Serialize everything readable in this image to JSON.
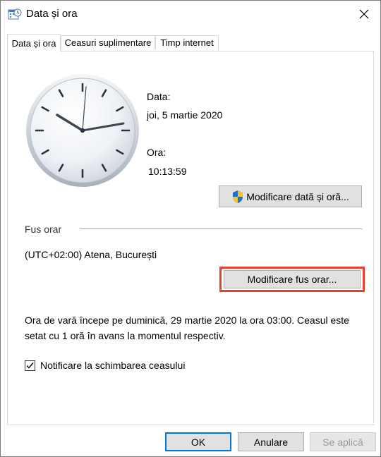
{
  "window": {
    "title": "Data și ora",
    "close_icon": "close-icon"
  },
  "tabs": [
    {
      "label": "Data și ora",
      "active": true
    },
    {
      "label": "Ceasuri suplimentare",
      "active": false
    },
    {
      "label": "Timp internet",
      "active": false
    }
  ],
  "datetime": {
    "date_label": "Data:",
    "date_value": "joi, 5 martie 2020",
    "time_label": "Ora:",
    "time_value": "10:13:59",
    "change_button": "Modificare dată și oră..."
  },
  "timezone": {
    "section_label": "Fus orar",
    "value": "(UTC+02:00) Atena, București",
    "change_button": "Modificare fus orar...",
    "dst_text": "Ora de vară începe pe duminică, 29 martie 2020 la ora 03:00. Ceasul este setat cu 1 oră în avans la momentul respectiv."
  },
  "notify": {
    "label": "Notificare la schimbarea ceasului",
    "checked": true
  },
  "footer": {
    "ok": "OK",
    "cancel": "Anulare",
    "apply": "Se aplică"
  },
  "colors": {
    "highlight": "#e8402b",
    "accent": "#0078d7",
    "disabled_text": "#9a9a9a"
  }
}
